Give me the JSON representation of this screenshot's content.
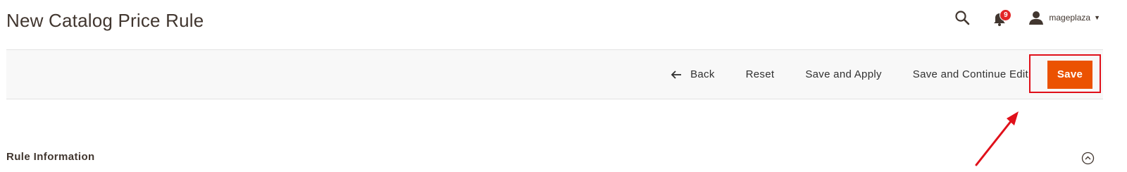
{
  "header": {
    "title": "New Catalog Price Rule",
    "notifications_count": "9",
    "user_name": "mageplaza"
  },
  "toolbar": {
    "back_label": "Back",
    "reset_label": "Reset",
    "save_apply_label": "Save and Apply",
    "save_continue_label": "Save and Continue Edit",
    "save_label": "Save"
  },
  "section": {
    "title": "Rule Information"
  },
  "colors": {
    "primary_button": "#eb5202",
    "highlight": "#e0101a",
    "badge": "#e22626"
  },
  "icons": [
    "search-icon",
    "bell-icon",
    "user-icon",
    "caret-down-icon",
    "arrow-left-icon",
    "chevron-up-icon"
  ]
}
